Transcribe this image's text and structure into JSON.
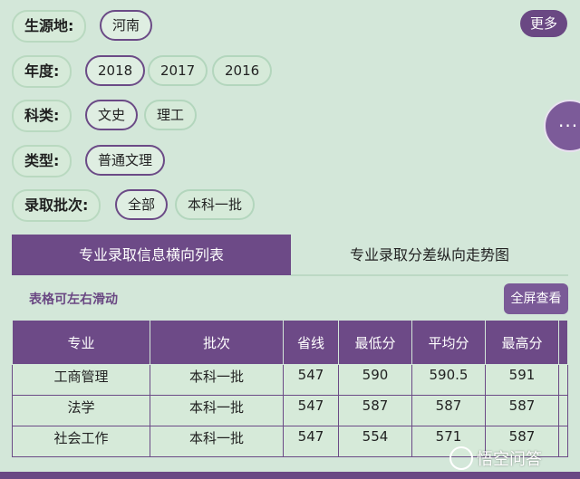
{
  "filters": {
    "origin": {
      "label": "生源地:",
      "options": [
        "河南"
      ]
    },
    "year": {
      "label": "年度:",
      "options": [
        "2018",
        "2017",
        "2016"
      ]
    },
    "subject": {
      "label": "科类:",
      "options": [
        "文史",
        "理工"
      ]
    },
    "type": {
      "label": "类型:",
      "options": [
        "普通文理"
      ]
    },
    "batch": {
      "label": "录取批次:",
      "options": [
        "全部",
        "本科一批"
      ]
    }
  },
  "more_label": "更多",
  "fab_label": "···",
  "tabs": [
    "专业录取信息横向列表",
    "专业录取分差纵向走势图"
  ],
  "hint": "表格可左右滑动",
  "fullscreen_label": "全屏查看",
  "table": {
    "headers": [
      "专业",
      "批次",
      "省线",
      "最低分",
      "平均分",
      "最高分"
    ],
    "rows": [
      [
        "工商管理",
        "本科一批",
        "547",
        "590",
        "590.5",
        "591"
      ],
      [
        "法学",
        "本科一批",
        "547",
        "587",
        "587",
        "587"
      ],
      [
        "社会工作",
        "本科一批",
        "547",
        "554",
        "571",
        "587"
      ]
    ]
  },
  "watermark": "悟空问答",
  "colors": {
    "accent": "#6d4a87",
    "background": "#d3e7d9"
  }
}
